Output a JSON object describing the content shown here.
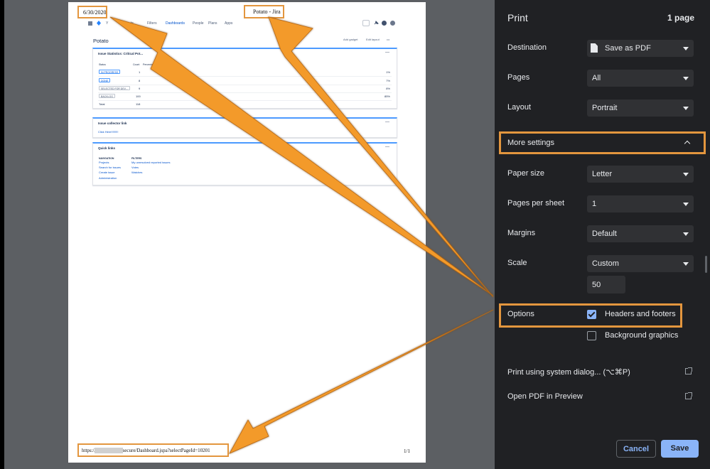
{
  "print_panel": {
    "title": "Print",
    "page_count": "1 page",
    "destination": {
      "label": "Destination",
      "value": "Save as PDF"
    },
    "pages": {
      "label": "Pages",
      "value": "All"
    },
    "layout": {
      "label": "Layout",
      "value": "Portrait"
    },
    "more_settings": {
      "label": "More settings"
    },
    "paper_size": {
      "label": "Paper size",
      "value": "Letter"
    },
    "pages_per_sheet": {
      "label": "Pages per sheet",
      "value": "1"
    },
    "margins": {
      "label": "Margins",
      "value": "Default"
    },
    "scale": {
      "label": "Scale",
      "value": "Custom",
      "custom_value": "50"
    },
    "options": {
      "label": "Options",
      "headers_footers": {
        "label": "Headers and footers",
        "checked": true
      },
      "background_graphics": {
        "label": "Background graphics",
        "checked": false
      }
    },
    "system_dialog": "Print using system dialog... (⌥⌘P)",
    "open_pdf": "Open PDF in Preview",
    "cancel_label": "Cancel",
    "save_label": "Save"
  },
  "page_preview": {
    "header_date": "6/30/2020",
    "header_title": "Potato - Jira",
    "footer_url": "https://          atlassian.net/secure/Dashboard.jspa?selectPageId=10201",
    "footer_page": "1/1",
    "jira": {
      "nav_items": [
        "Y",
        "ts",
        "Filters",
        "Dashboards",
        "People",
        "Plans",
        "Apps"
      ],
      "dashboard_title": "Potato",
      "add_gadget": "Add gadget",
      "edit_layout": "Edit layout",
      "more": "•••",
      "stats_gadget": {
        "title": "Issue Statistics: Critical Pot...",
        "headers": [
          "Status",
          "Count",
          "Percentage"
        ],
        "rows": [
          {
            "status": "IN PROGRESS",
            "count": "1",
            "percent": "1%"
          },
          {
            "status": "DONE",
            "count": "8",
            "percent": "7%"
          },
          {
            "status": "SELECTED FOR DEV...",
            "count": "9",
            "percent": "8%"
          },
          {
            "status": "BACKLOG",
            "count": "100",
            "percent": "85%"
          }
        ],
        "total_label": "Total",
        "total_value": "118"
      },
      "collector_gadget": {
        "title": "Issue collector link",
        "link": "Click Here!!!!!!!!!"
      },
      "quick_links": {
        "title": "Quick links",
        "nav_header": "NAVIGATION",
        "nav_links": [
          "Projects",
          "Search for issues",
          "Create issue",
          "Administration"
        ],
        "filters_header": "FILTERS",
        "filter_links": [
          "My unresolved reported issues",
          "Votes",
          "Watches"
        ]
      }
    }
  },
  "colors": {
    "annotation": "#e3963e",
    "arrow_fill": "#f39a2c",
    "panel_bg": "#202124",
    "accent": "#8ab4f8"
  }
}
